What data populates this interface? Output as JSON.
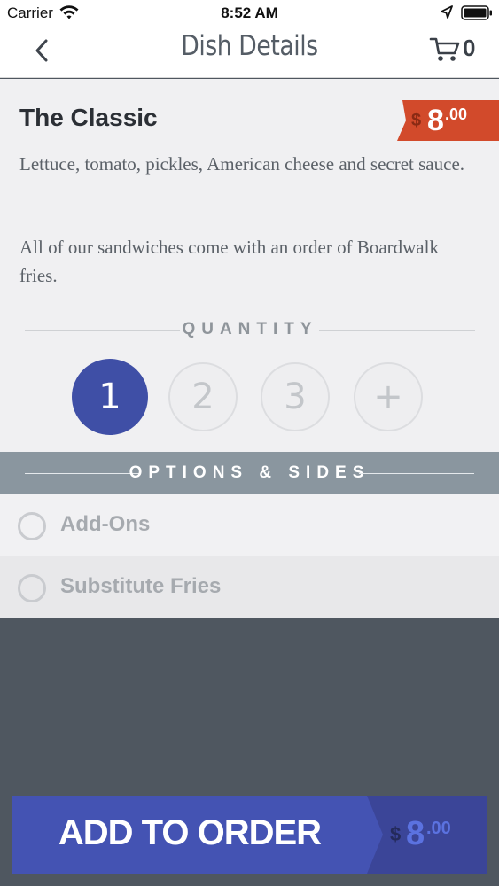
{
  "status_bar": {
    "carrier": "Carrier",
    "time": "8:52 AM",
    "icons": [
      "wifi-icon",
      "location-arrow-icon",
      "battery-icon"
    ]
  },
  "nav": {
    "title": "Dish Details",
    "cart_count": "0",
    "icons": [
      "chevron-left-icon",
      "cart-icon"
    ]
  },
  "dish": {
    "name": "The Classic",
    "price": {
      "currency": "$",
      "amount": "8",
      "cents": ".00"
    },
    "description": "Lettuce, tomato, pickles, American cheese and secret sauce.",
    "note": "All of our sandwiches come with an order of Boardwalk fries."
  },
  "quantity": {
    "label": "QUANTITY",
    "options": [
      "1",
      "2",
      "3",
      "+"
    ],
    "selected": "1"
  },
  "options_sides": {
    "label": "OPTIONS & SIDES",
    "items": [
      {
        "label": "Add-Ons"
      },
      {
        "label": "Substitute Fries"
      }
    ]
  },
  "add_to_order": {
    "label": "ADD TO ORDER",
    "currency": "$",
    "amount": "8",
    "cents": ".00"
  },
  "colors": {
    "accent": "#3f4fa6",
    "price_tag": "#d24a2b",
    "options_header": "#8a969f",
    "footer_bg": "#4f5760"
  }
}
